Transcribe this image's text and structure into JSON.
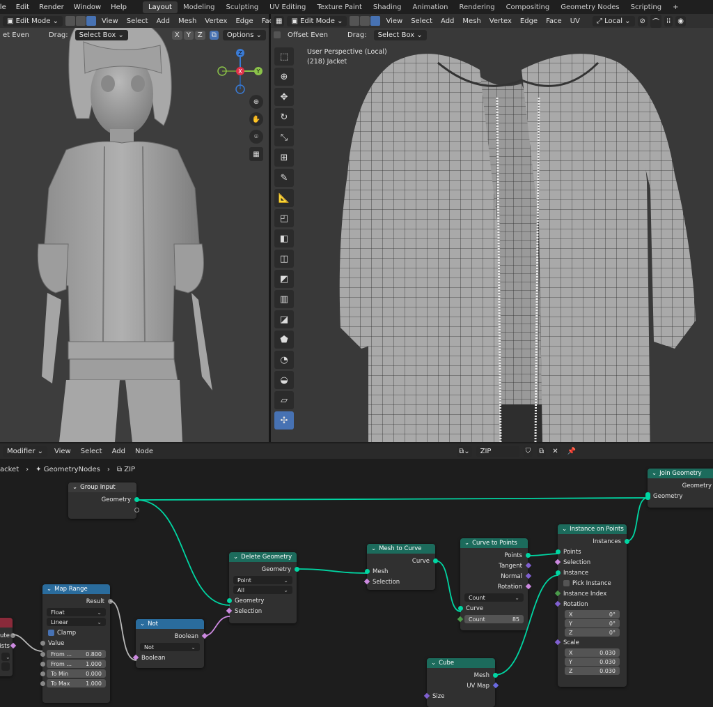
{
  "menu": [
    "File",
    "Edit",
    "Render",
    "Window",
    "Help"
  ],
  "workspaces": [
    "Layout",
    "Modeling",
    "Sculpting",
    "UV Editing",
    "Texture Paint",
    "Shading",
    "Animation",
    "Rendering",
    "Compositing",
    "Geometry Nodes",
    "Scripting",
    "+"
  ],
  "left_header": {
    "mode": "Edit Mode",
    "menus": [
      "View",
      "Select",
      "Add",
      "Mesh",
      "Vertex",
      "Edge",
      "Face"
    ]
  },
  "left_sub": {
    "offset_even": "et Even",
    "drag_label": "Drag:",
    "drag_value": "Select Box",
    "xyz": [
      "X",
      "Y",
      "Z"
    ],
    "options": "Options"
  },
  "right_header": {
    "mode": "Edit Mode",
    "menus": [
      "View",
      "Select",
      "Add",
      "Mesh",
      "Vertex",
      "Edge",
      "Face",
      "UV"
    ],
    "transform": "Local"
  },
  "right_sub": {
    "offset_even": "Offset Even",
    "drag_label": "Drag:",
    "drag_value": "Select Box"
  },
  "viewport_info": {
    "line1": "User Perspective (Local)",
    "line2": "(218) Jacket"
  },
  "gizmo": {
    "z": "Z",
    "x": "X",
    "y": "Y"
  },
  "node_header": {
    "editor": "Modifier",
    "menus": [
      "View",
      "Select",
      "Add",
      "Node"
    ],
    "tree_name": "ZIP"
  },
  "breadcrumb": [
    "acket",
    "GeometryNodes",
    "ZIP"
  ],
  "nodes": {
    "group_input": {
      "title": "Group Input",
      "out": "Geometry"
    },
    "join": {
      "title": "Join Geometry",
      "out": "Geometry",
      "in": "Geometry"
    },
    "delete": {
      "title": "Delete Geometry",
      "out": "Geometry",
      "domain": "Point",
      "mode": "All",
      "in_geo": "Geometry",
      "in_sel": "Selection"
    },
    "mesh2curve": {
      "title": "Mesh to Curve",
      "out": "Curve",
      "in_mesh": "Mesh",
      "in_sel": "Selection"
    },
    "curve2points": {
      "title": "Curve to Points",
      "outs": [
        "Points",
        "Tangent",
        "Normal",
        "Rotation"
      ],
      "mode": "Count",
      "in_curve": "Curve",
      "count_label": "Count",
      "count_value": "85"
    },
    "instance": {
      "title": "Instance on Points",
      "out": "Instances",
      "ins": [
        "Points",
        "Selection",
        "Instance"
      ],
      "pick": "Pick Instance",
      "index": "Instance Index",
      "rotation": "Rotation",
      "rot": [
        {
          "a": "X",
          "v": "0°"
        },
        {
          "a": "Y",
          "v": "0°"
        },
        {
          "a": "Z",
          "v": "0°"
        }
      ],
      "scale": "Scale",
      "scl": [
        {
          "a": "X",
          "v": "0.030"
        },
        {
          "a": "Y",
          "v": "0.030"
        },
        {
          "a": "Z",
          "v": "0.030"
        }
      ]
    },
    "maprange": {
      "title": "Map Range",
      "out": "Result",
      "type": "Float",
      "interp": "Linear",
      "clamp": "Clamp",
      "value": "Value",
      "fields": [
        {
          "l": "From ...",
          "v": "0.800"
        },
        {
          "l": "From ...",
          "v": "1.000"
        },
        {
          "l": "To Min",
          "v": "0.000"
        },
        {
          "l": "To Max",
          "v": "1.000"
        }
      ]
    },
    "not": {
      "title": "Not",
      "out": "Boolean",
      "op": "Not",
      "in": "Boolean"
    },
    "cube": {
      "title": "Cube",
      "out_mesh": "Mesh",
      "out_uv": "UV Map",
      "size": "Size"
    },
    "partial": {
      "r1": "ute",
      "r2": "ists"
    }
  },
  "colors": {
    "accent": "#4772b3",
    "geometry_socket": "#00d6a3",
    "geo_header": "#1c6b5c",
    "util_header": "#2a6c9d"
  }
}
